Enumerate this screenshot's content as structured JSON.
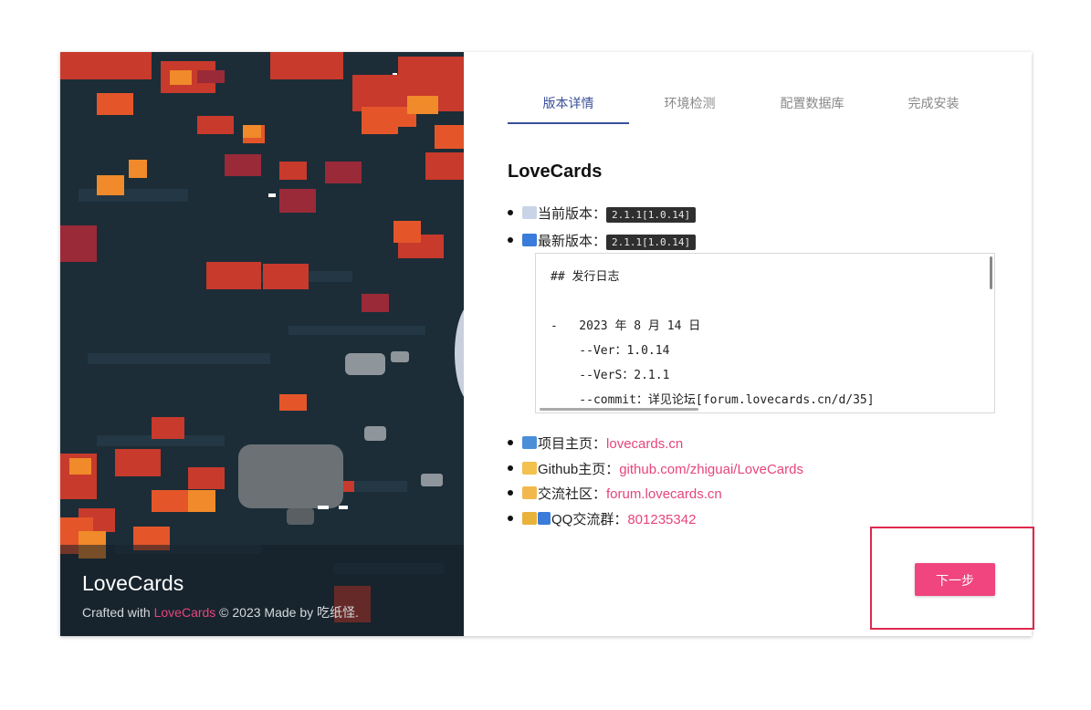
{
  "left_panel": {
    "brand": "LoveCards",
    "credit_prefix": "Crafted with ",
    "credit_link": "LoveCards",
    "credit_suffix": " © 2023 Made by 吃纸怪."
  },
  "tabs": [
    {
      "label": "版本详情",
      "active": true
    },
    {
      "label": "环境检测",
      "active": false
    },
    {
      "label": "配置数据库",
      "active": false
    },
    {
      "label": "完成安装",
      "active": false
    }
  ],
  "section_title": "LoveCards",
  "version": {
    "current_label": "当前版本：",
    "current_value": "2.1.1[1.0.14]",
    "latest_label": "最新版本：",
    "latest_value": "2.1.1[1.0.14]"
  },
  "changelog": {
    "heading": "## 发行日志",
    "line1": "-   2023 年 8 月 14 日",
    "line2": "    --Ver：1.0.14",
    "line3": "    --VerS：2.1.1",
    "line4": "    --commit：详见论坛[forum.lovecards.cn/d/35]"
  },
  "links": [
    {
      "label": "项目主页：",
      "value": "lovecards.cn",
      "icon": "laptop-icon"
    },
    {
      "label": "Github主页：",
      "value": "github.com/zhiguai/LoveCards",
      "icon": "developer-icon"
    },
    {
      "label": "交流社区：",
      "value": "forum.lovecards.cn",
      "icon": "people-icon"
    },
    {
      "label": "QQ交流群：",
      "value": "801235342",
      "icon": "group-icon"
    }
  ],
  "next_button": "下一步",
  "colors": {
    "accent": "#f0457f",
    "tab_active": "#3a4f9a",
    "highlight": "#e0294d",
    "panel_bg": "#1c2d37"
  }
}
